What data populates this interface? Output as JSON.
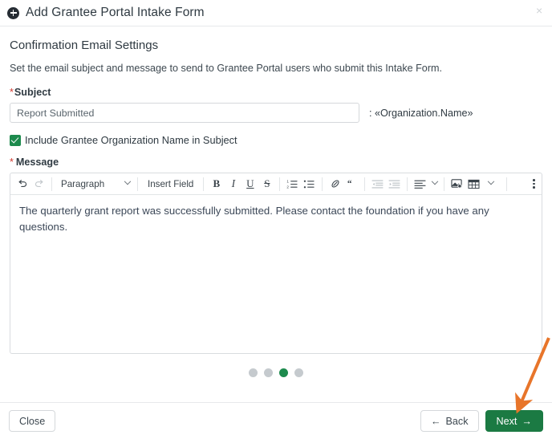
{
  "dialog": {
    "title": "Add Grantee Portal Intake Form",
    "add_icon": "plus-circle-icon",
    "close_icon": "×"
  },
  "content": {
    "section_title": "Confirmation Email Settings",
    "section_description": "Set the email subject and message to send to Grantee Portal users who submit this Intake Form.",
    "subject": {
      "label": "Subject",
      "required_marker": "*",
      "value": "Report Submitted",
      "placeholder": "Report Submitted",
      "suffix": ": «Organization.Name»"
    },
    "include_org_checkbox": {
      "label": "Include Grantee Organization Name in Subject",
      "checked": true
    },
    "message": {
      "label": "Message",
      "required_marker": "*",
      "body": "The quarterly grant report was successfully submitted. Please contact the foundation if you have any questions."
    }
  },
  "toolbar": {
    "undo_icon": "↶",
    "redo_icon": "↷",
    "paragraph_style": "Paragraph",
    "insert_field": "Insert Field",
    "bold": "B",
    "italic": "I",
    "underline": "U",
    "strikethrough": "S",
    "numbered_list_icon": "ordered-list-icon",
    "bullet_list_icon": "bullet-list-icon",
    "link_icon": "link-icon",
    "quote_icon": "“",
    "outdent_icon": "outdent-icon",
    "indent_icon": "indent-icon",
    "align_icon": "align-left-icon",
    "image_icon": "image-icon",
    "table_icon": "table-icon",
    "more_icon": "kebab-menu-icon"
  },
  "steps": {
    "total": 4,
    "active_index": 2
  },
  "footer": {
    "close": "Close",
    "back": "Back",
    "back_icon": "←",
    "next": "Next",
    "next_icon": "→"
  },
  "colors": {
    "accent_green": "#1b7a43",
    "checkbox_green": "#1d8a4d",
    "required_red": "#d0352b",
    "annotation_orange": "#e8752a",
    "step_inactive": "#c5cace"
  }
}
